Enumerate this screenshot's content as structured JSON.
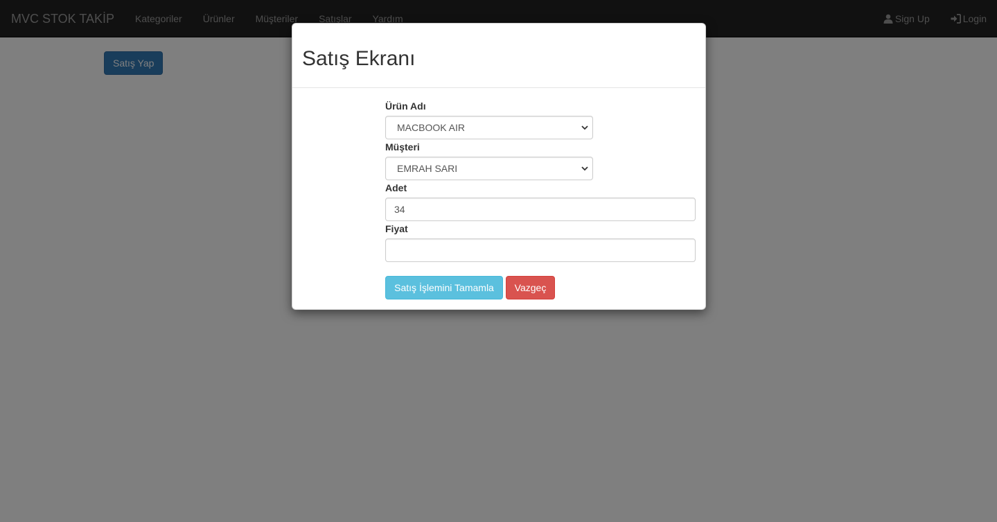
{
  "navbar": {
    "brand": "MVC STOK TAKİP",
    "links": [
      "Kategoriler",
      "Ürünler",
      "Müşteriler",
      "Satışlar",
      "Yardım"
    ],
    "signup": {
      "label": "Sign Up",
      "icon": "user-icon"
    },
    "login": {
      "label": "Login",
      "icon": "login-icon"
    }
  },
  "page": {
    "sale_button": "Satış Yap"
  },
  "modal": {
    "title": "Satış Ekranı",
    "product": {
      "label": "Ürün Adı",
      "value": "MACBOOK AIR"
    },
    "customer": {
      "label": "Müşteri",
      "value": "EMRAH SARI"
    },
    "quantity": {
      "label": "Adet",
      "value": "34"
    },
    "price": {
      "label": "Fiyat",
      "value": ""
    },
    "complete_button": "Satış İşlemini Tamamla",
    "cancel_button": "Vazgeç"
  },
  "colors": {
    "navbar_bg": "#222222",
    "primary": "#337ab7",
    "info": "#5bc0de",
    "danger": "#d9534f",
    "backdrop": "#000000"
  }
}
